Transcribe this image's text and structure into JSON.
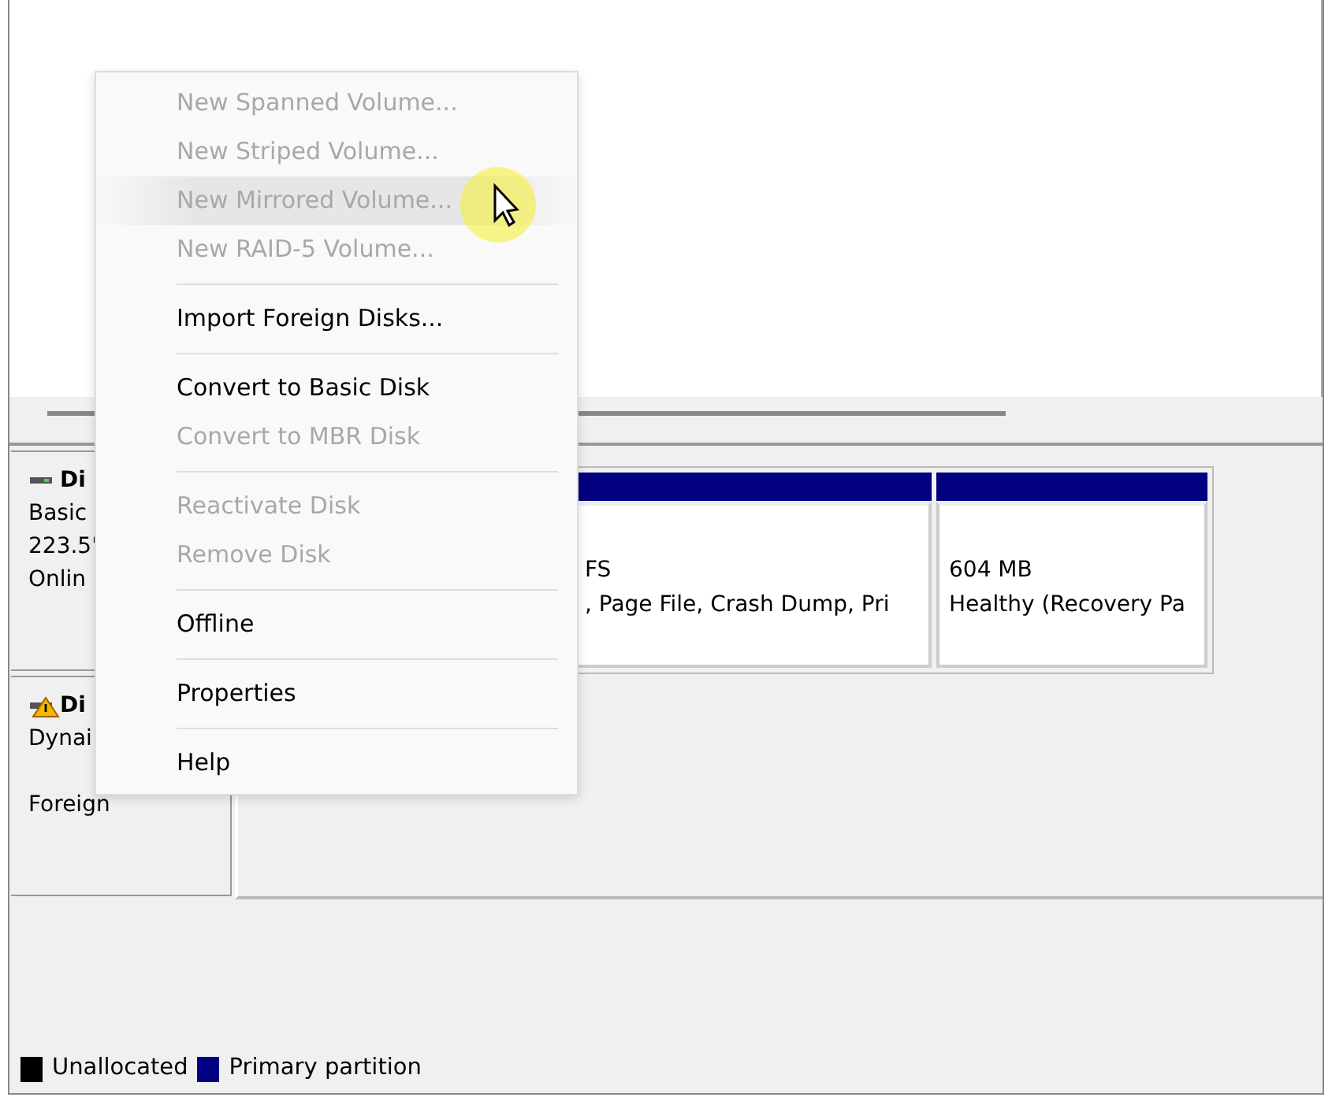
{
  "context_menu": [
    {
      "kind": "item",
      "label": "New Spanned Volume...",
      "disabled": true,
      "hovered": false
    },
    {
      "kind": "item",
      "label": "New Striped Volume...",
      "disabled": true,
      "hovered": false
    },
    {
      "kind": "item",
      "label": "New Mirrored Volume...",
      "disabled": true,
      "hovered": true
    },
    {
      "kind": "item",
      "label": "New RAID-5 Volume...",
      "disabled": true,
      "hovered": false
    },
    {
      "kind": "separator"
    },
    {
      "kind": "item",
      "label": "Import Foreign Disks...",
      "disabled": false,
      "hovered": false
    },
    {
      "kind": "separator"
    },
    {
      "kind": "item",
      "label": "Convert to Basic Disk",
      "disabled": false,
      "hovered": false
    },
    {
      "kind": "item",
      "label": "Convert to MBR Disk",
      "disabled": true,
      "hovered": false
    },
    {
      "kind": "separator"
    },
    {
      "kind": "item",
      "label": "Reactivate Disk",
      "disabled": true,
      "hovered": false
    },
    {
      "kind": "item",
      "label": "Remove Disk",
      "disabled": true,
      "hovered": false
    },
    {
      "kind": "separator"
    },
    {
      "kind": "item",
      "label": "Offline",
      "disabled": false,
      "hovered": false
    },
    {
      "kind": "separator"
    },
    {
      "kind": "item",
      "label": "Properties",
      "disabled": false,
      "hovered": false
    },
    {
      "kind": "separator"
    },
    {
      "kind": "item",
      "label": "Help",
      "disabled": false,
      "hovered": false
    }
  ],
  "disks": [
    {
      "name": "Di",
      "warning": false,
      "lines": [
        "Basic",
        "223.5'",
        "Onlin"
      ],
      "partitions": [
        {
          "lines": [
            "FS",
            ", Page File, Crash Dump, Pri"
          ]
        },
        {
          "lines": [
            "604 MB",
            "Healthy (Recovery Pa"
          ]
        }
      ]
    },
    {
      "name": "Di",
      "warning": true,
      "lines": [
        "Dynai",
        "Foreign"
      ]
    }
  ],
  "legend": [
    {
      "label": "Unallocated",
      "color": "#000000"
    },
    {
      "label": "Primary partition",
      "color": "#000080"
    }
  ]
}
